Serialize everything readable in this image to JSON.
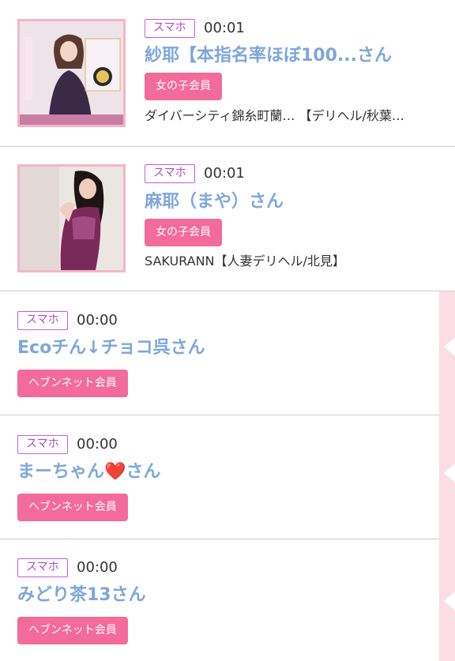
{
  "entries": [
    {
      "device": "スマホ",
      "time": "00:01",
      "name": "紗耶【本指名率ほぼ100...さん",
      "member_type": "女の子会員",
      "shop": "ダイバーシティ錦糸町蘭… 【デリヘル/秋葉…"
    },
    {
      "device": "スマホ",
      "time": "00:01",
      "name": "麻耶（まや）さん",
      "member_type": "女の子会員",
      "shop": "SAKURANN【人妻デリヘル/北見】"
    },
    {
      "device": "スマホ",
      "time": "00:00",
      "name": "Ecoチん↓チョコ呉さん",
      "member_type": "ヘブンネット会員"
    },
    {
      "device": "スマホ",
      "time": "00:00",
      "name": "まーちゃん❤️さん",
      "member_type": "ヘブンネット会員"
    },
    {
      "device": "スマホ",
      "time": "00:00",
      "name": "みどり茶13さん",
      "member_type": "ヘブンネット会員"
    }
  ],
  "colors": {
    "name_text": "#7ea7db",
    "member_badge_bg": "#f36b9a",
    "device_badge_border": "#c55fd6",
    "thumb_border": "#f4b6c8",
    "side_strip": "#fbdde6"
  },
  "icons": {
    "thumb1": "profile-photo",
    "thumb2": "profile-photo",
    "side_notch": "speech-notch"
  }
}
